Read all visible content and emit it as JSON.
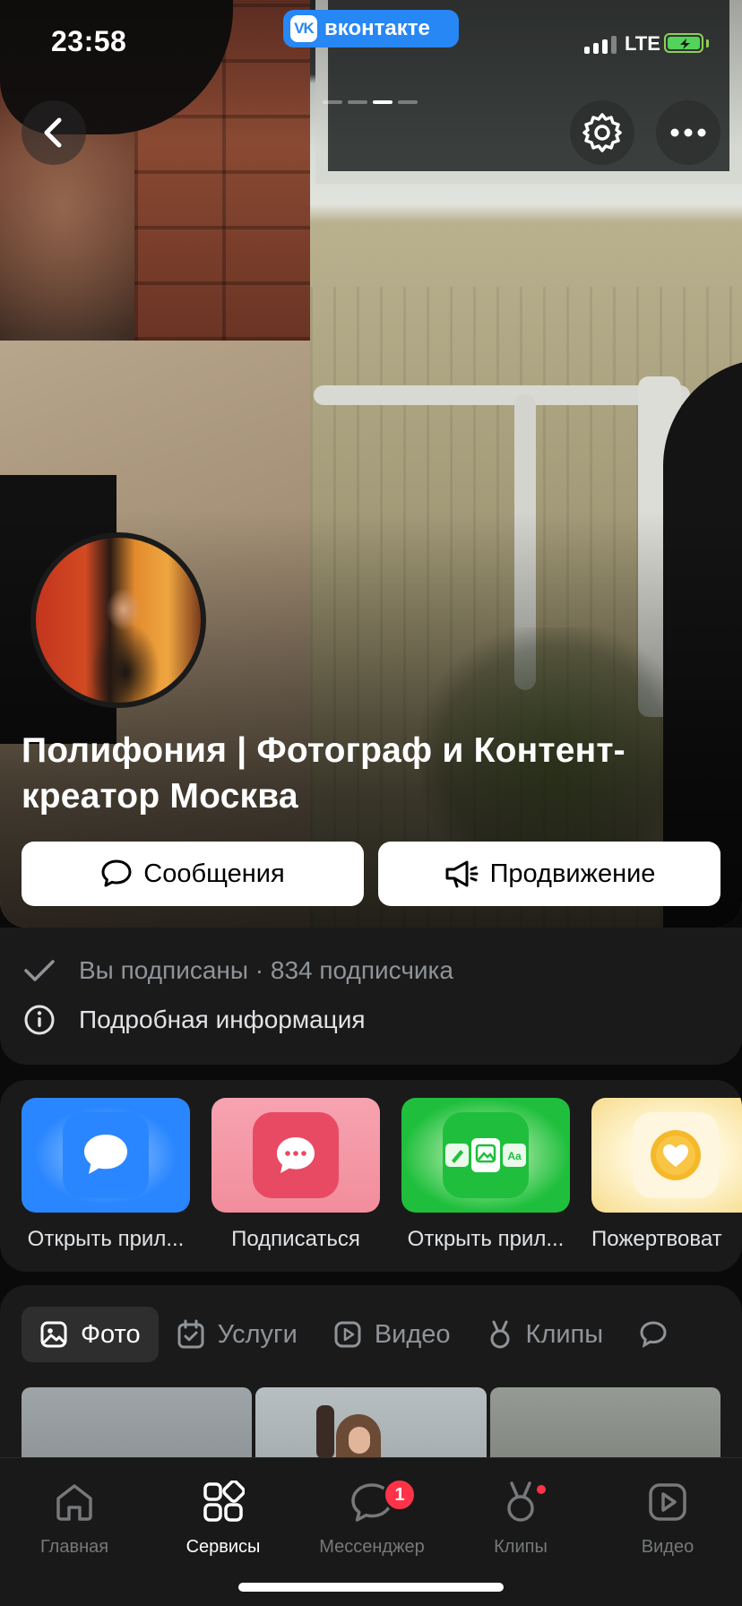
{
  "status_bar": {
    "time": "23:58",
    "app_pill": "вконтакте",
    "app_logo": "VK",
    "network": "LTE"
  },
  "header": {
    "back_icon": "chevron-left-icon",
    "settings_icon": "gear-icon",
    "more_icon": "more-horizontal-icon"
  },
  "community": {
    "title": "Полифония | Фотограф и Контент-креатор Москва",
    "buttons": {
      "messages": "Сообщения",
      "promotion": "Продвижение"
    },
    "subscription_status": "Вы подписаны · 834 подписчика",
    "details_link": "Подробная информация"
  },
  "apps": [
    {
      "label": "Открыть прил...",
      "icon": "chat-bubble-icon",
      "color": "#2a86ff"
    },
    {
      "label": "Подписаться",
      "icon": "message-dots-icon",
      "color": "#e84a63"
    },
    {
      "label": "Открыть прил...",
      "icon": "editor-icon",
      "color": "#1fbf3d"
    },
    {
      "label": "Пожертвоват",
      "icon": "heart-icon",
      "color": "#f5b829"
    }
  ],
  "tabs": [
    {
      "label": "Фото",
      "icon": "photo-icon",
      "active": true
    },
    {
      "label": "Услуги",
      "icon": "calendar-check-icon",
      "active": false
    },
    {
      "label": "Видео",
      "icon": "play-icon",
      "active": false
    },
    {
      "label": "Клипы",
      "icon": "clips-icon",
      "active": false
    }
  ],
  "tabbar": [
    {
      "label": "Главная",
      "icon": "home-icon",
      "active": false
    },
    {
      "label": "Сервисы",
      "icon": "services-grid-icon",
      "active": true
    },
    {
      "label": "Мессенджер",
      "icon": "messenger-icon",
      "active": false,
      "badge": "1"
    },
    {
      "label": "Клипы",
      "icon": "clips-icon",
      "active": false,
      "dot": true
    },
    {
      "label": "Видео",
      "icon": "video-icon",
      "active": false
    }
  ],
  "colors": {
    "accent": "#2787f5",
    "background": "#0a0a0a",
    "card": "#1a1a1a",
    "badge": "#ff3347"
  }
}
